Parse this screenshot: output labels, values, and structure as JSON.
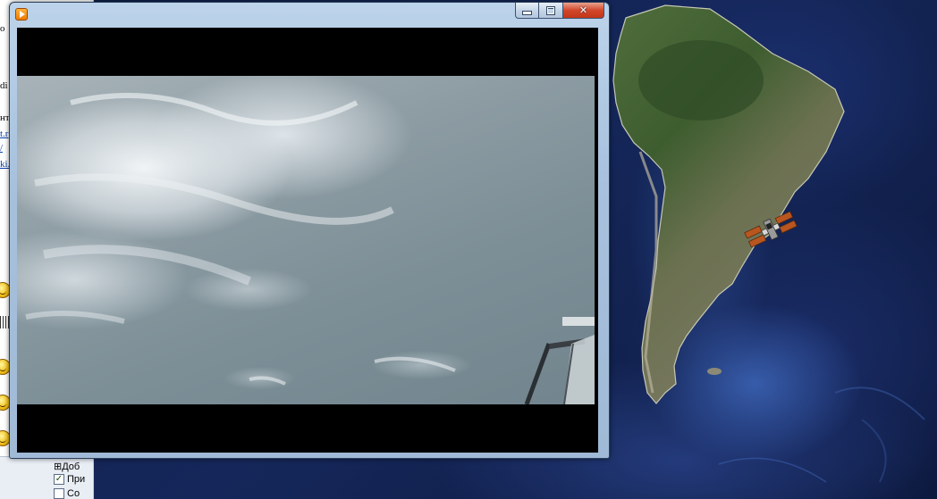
{
  "desktop": {
    "background_app": {
      "fragments": [
        "о",
        "di",
        "нт",
        "t.r",
        "/",
        "ki.",
        "ki."
      ],
      "bottom_panel": {
        "group_label": "⊞Доб",
        "checkbox_1_label": "При",
        "checkbox_1_checked": true,
        "checkbox_2_label": "Со",
        "checkbox_2_checked": false
      }
    },
    "map_view": {
      "subject": "South America satellite view with space station marker",
      "marker_icon": "satellite-icon"
    }
  },
  "player_window": {
    "app_icon": "play-icon",
    "minimize_glyph": "minimize-icon",
    "maximize_glyph": "maximize-icon",
    "close_glyph": "✕",
    "content": "Earth from orbit video (clouds over ocean)"
  }
}
